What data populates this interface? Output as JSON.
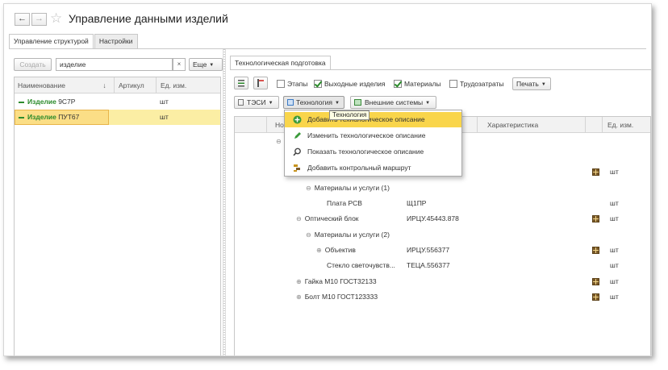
{
  "window": {
    "title": "Управление данными изделий",
    "back_icon": "arrow-left-icon",
    "forward_icon": "arrow-right-icon",
    "favorite_icon": "star-icon"
  },
  "tabs": [
    {
      "label": "Управление структурой",
      "active": true
    },
    {
      "label": "Настройки",
      "active": false
    }
  ],
  "left": {
    "create_label": "Создать",
    "search_value": "изделие",
    "clear_label": "×",
    "more_label": "Еще",
    "columns": {
      "name": "Наименование",
      "sort": "↓",
      "article": "Артикул",
      "unit": "Ед. изм."
    },
    "rows": [
      {
        "prefix": "Изделие",
        "name": "9С7Р",
        "unit": "шт"
      },
      {
        "prefix": "Изделие",
        "name": "ПУТ67",
        "unit": "шт"
      }
    ]
  },
  "right": {
    "tab_label": "Технологическая подготовка",
    "checks": {
      "stages": "Этапы",
      "outputs": "Выходные изделия",
      "materials": "Материалы",
      "labor": "Трудозатраты"
    },
    "print_label": "Печать",
    "tsi_label": "ТЭСИ",
    "tech_label": "Технология",
    "ext_label": "Внешние системы",
    "columns": {
      "name": "Но",
      "characteristic": "Характеристика",
      "unit": "Ед. изм."
    },
    "rows": [
      {
        "name": "",
        "code": "",
        "unit": ""
      },
      {
        "name": "",
        "code": "",
        "unit": ""
      },
      {
        "name": "",
        "code": "",
        "unit": "шт"
      },
      {
        "name": "Материалы и услуги (1)",
        "code": "",
        "unit": ""
      },
      {
        "name": "Плата PCB",
        "code": "Щ1ПР",
        "unit": "шт"
      },
      {
        "name": "Оптический блок",
        "code": "ИРЦУ.45443.878",
        "unit": "шт"
      },
      {
        "name": "Материалы и услуги (2)",
        "code": "",
        "unit": ""
      },
      {
        "name": "Объектив",
        "code": "ИРЦУ.556377",
        "unit": "шт"
      },
      {
        "name": "Стекло светочувств...",
        "code": "ТЕЦА.556377",
        "unit": "шт"
      },
      {
        "name": "Гайка М10 ГОСТ32133",
        "code": "",
        "unit": "шт"
      },
      {
        "name": "Болт М10 ГОСТ123333",
        "code": "",
        "unit": "шт"
      }
    ]
  },
  "dropdown": {
    "tooltip": "Технология",
    "items": [
      {
        "label": "Добавить технологическое описание",
        "icon": "add-circle-icon"
      },
      {
        "label": "Изменить технологическое описание",
        "icon": "pencil-icon"
      },
      {
        "label": "Показать технологическое описание",
        "icon": "magnifier-icon"
      },
      {
        "label": "Добавить контрольный маршрут",
        "icon": "route-icon"
      }
    ]
  }
}
